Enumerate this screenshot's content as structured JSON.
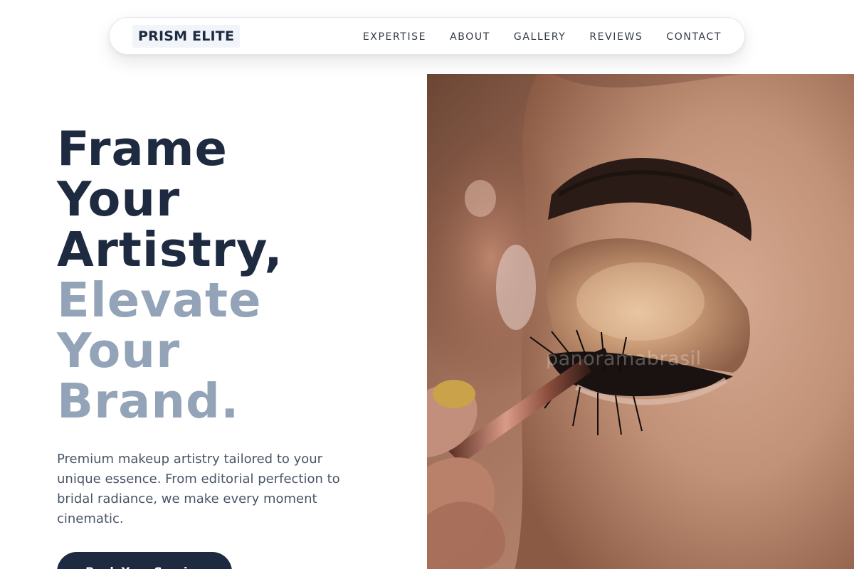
{
  "brand": {
    "logo": "PRISM ELITE"
  },
  "nav": {
    "links": [
      "EXPERTISE",
      "ABOUT",
      "GALLERY",
      "REVIEWS",
      "CONTACT"
    ]
  },
  "hero": {
    "headline_lines": [
      "Frame",
      "Your",
      "Artistry,",
      "Elevate",
      "Your",
      "Brand."
    ],
    "description": "Premium makeup artistry tailored to your unique essence. From editorial perfection to bridal radiance, we make every moment cinematic.",
    "cta_label": "Book Your Session",
    "image_watermark": "panoramabrasil"
  },
  "colors": {
    "primary": "#1d2a40",
    "muted_heading": "#93a3b8",
    "body_text": "#4a5566",
    "nav_text": "#333a45"
  }
}
